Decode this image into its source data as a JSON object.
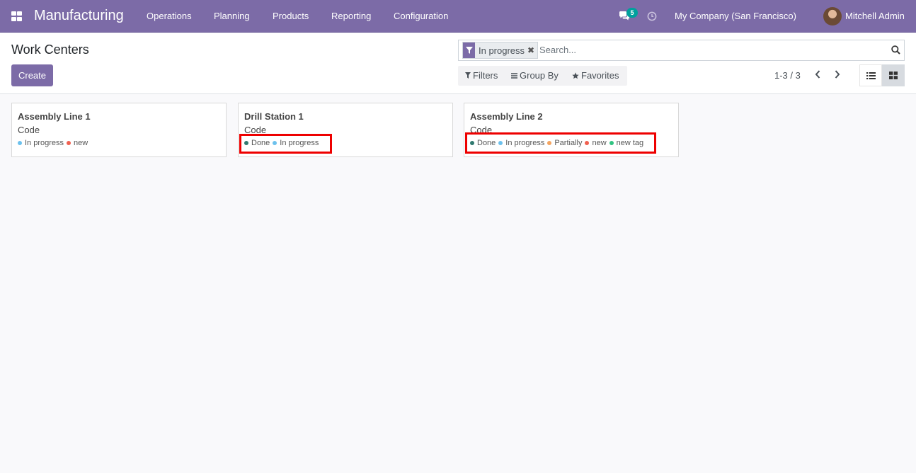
{
  "navbar": {
    "app_name": "Manufacturing",
    "menu": [
      "Operations",
      "Planning",
      "Products",
      "Reporting",
      "Configuration"
    ],
    "messages_count": "5",
    "company": "My Company (San Francisco)",
    "user": "Mitchell Admin",
    "icons": {
      "apps": "grid-icon",
      "messages": "chat-icon",
      "activities": "clock-icon"
    }
  },
  "control_panel": {
    "title": "Work Centers",
    "create_label": "Create",
    "search": {
      "facet_label": "In progress",
      "placeholder": "Search..."
    },
    "filters_label": "Filters",
    "group_by_label": "Group By",
    "favorites_label": "Favorites",
    "pager": "1-3 / 3"
  },
  "cards": [
    {
      "title": "Assembly Line 1",
      "code": "Code",
      "tags": [
        {
          "label": "In progress",
          "color": "#6cc1ed"
        },
        {
          "label": "new",
          "color": "#f06050"
        }
      ]
    },
    {
      "title": "Drill Station 1",
      "code": "Code",
      "tags": [
        {
          "label": "Done",
          "color": "#30796f"
        },
        {
          "label": "In progress",
          "color": "#6cc1ed"
        }
      ]
    },
    {
      "title": "Assembly Line 2",
      "code": "Code",
      "tags": [
        {
          "label": "Done",
          "color": "#30796f"
        },
        {
          "label": "In progress",
          "color": "#6cc1ed"
        },
        {
          "label": "Partially",
          "color": "#f4a460"
        },
        {
          "label": "new",
          "color": "#f06050"
        },
        {
          "label": "new tag",
          "color": "#30c381"
        }
      ]
    }
  ],
  "colors": {
    "brand": "#7c6ba7",
    "highlight": "#ee0000",
    "badge": "#00a09d"
  }
}
